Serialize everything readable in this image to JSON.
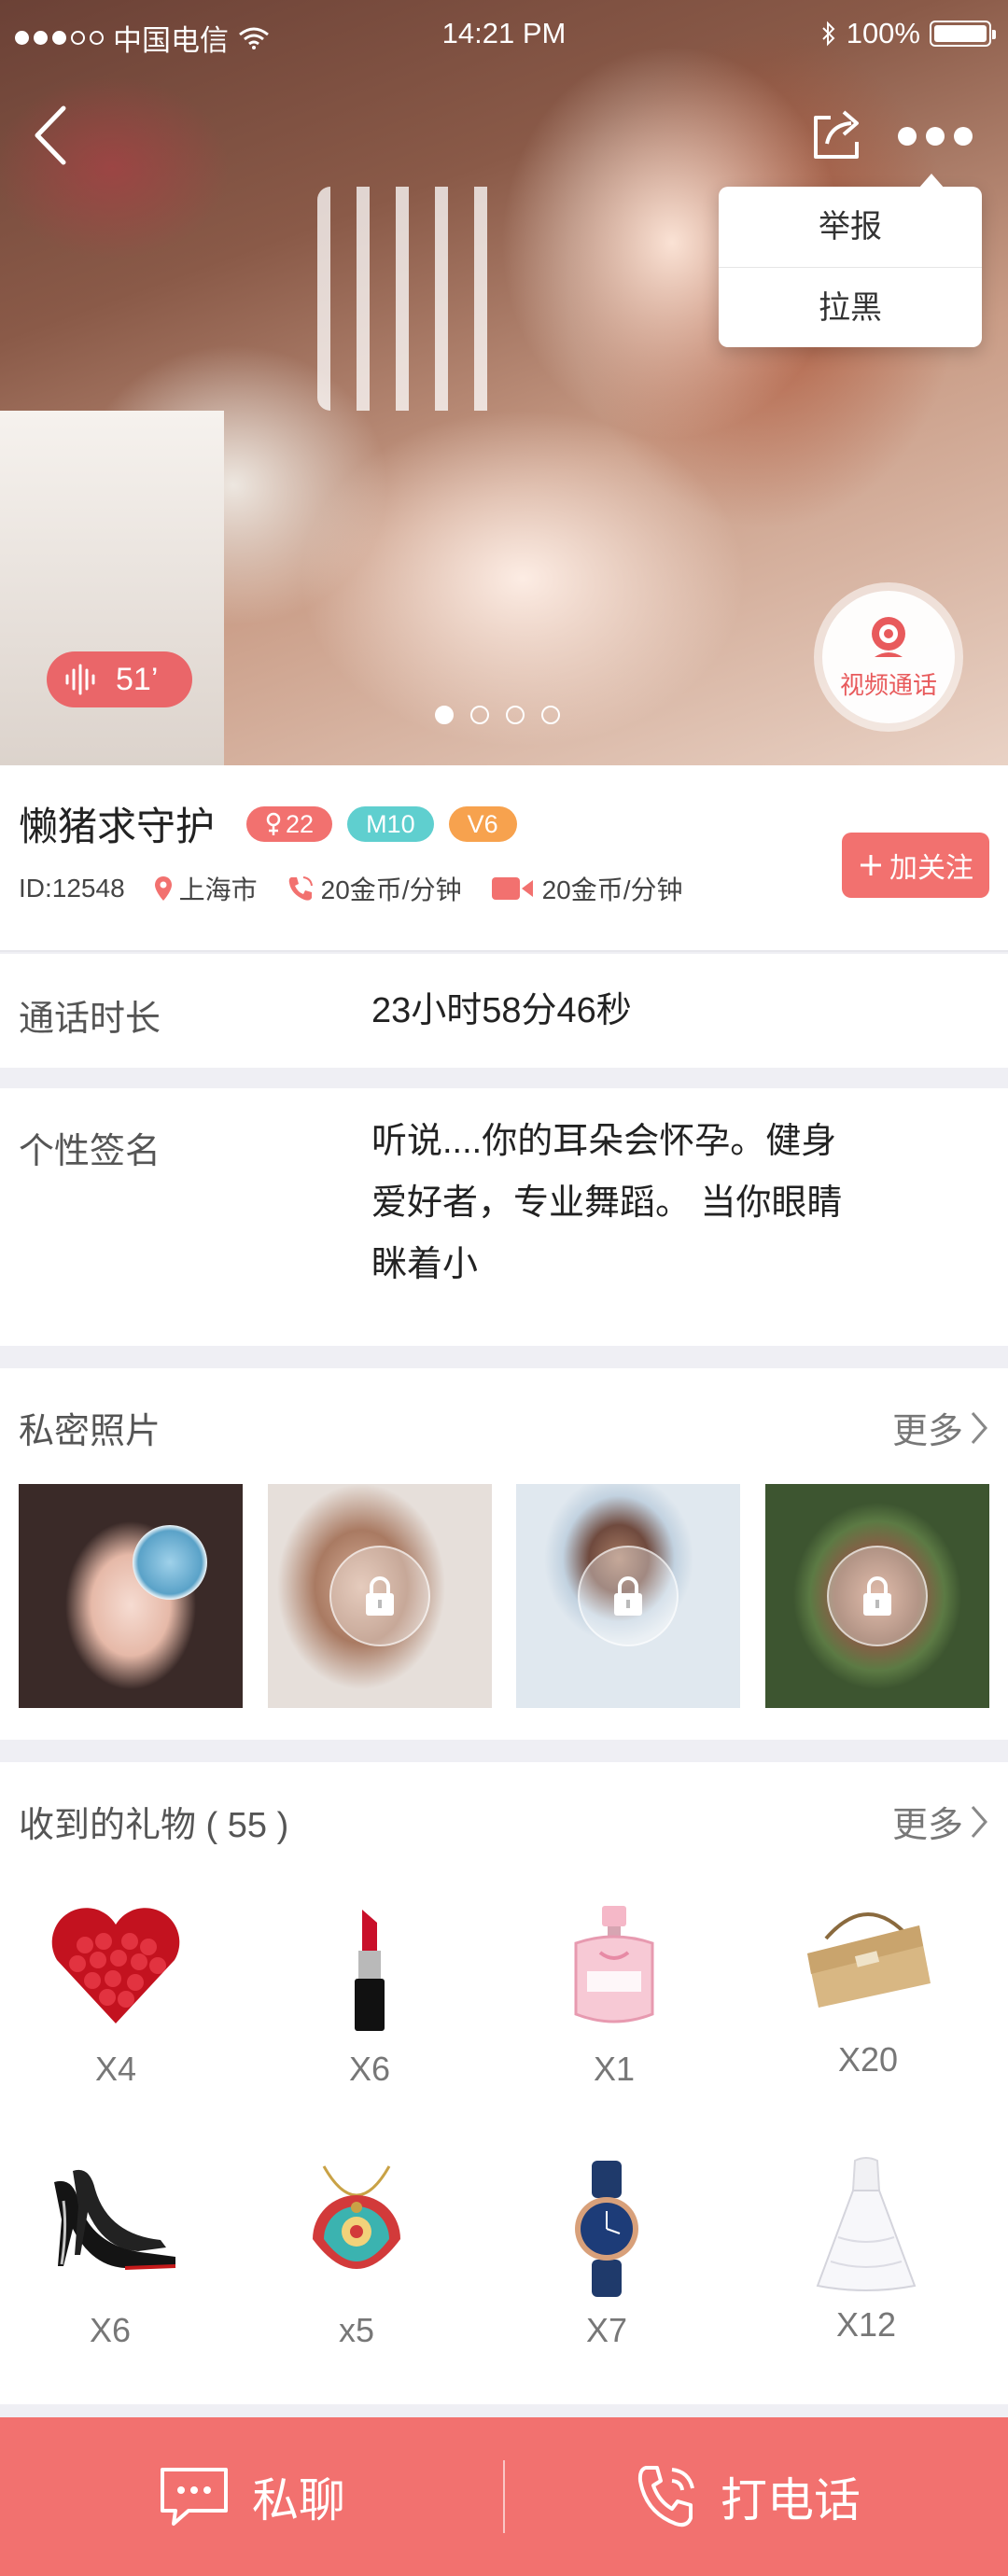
{
  "status_bar": {
    "carrier": "中国电信",
    "time": "14:21 PM",
    "battery": "100%"
  },
  "menu": {
    "items": [
      "举报",
      "拉黑"
    ]
  },
  "hero": {
    "voice_duration": "51’",
    "video_call_label": "视频通话",
    "page_dots": 4,
    "active_dot": 0
  },
  "profile": {
    "nickname": "懒猪求守护",
    "gender_badge": "22",
    "level_badge": "M10",
    "vip_badge": "V6",
    "id": "ID:12548",
    "city": "上海市",
    "voice_price": "20金币/分钟",
    "video_price": "20金币/分钟",
    "follow_label": "加关注"
  },
  "call_duration": {
    "label": "通话时长",
    "value": "23小时58分46秒"
  },
  "signature": {
    "label": "个性签名",
    "lines": [
      "听说....你的耳朵会怀孕。健身",
      "爱好者，专业舞蹈。 当你眼睛",
      "眯着小"
    ]
  },
  "private_photos": {
    "title": "私密照片",
    "more": "更多",
    "photos": [
      {
        "locked": false
      },
      {
        "locked": true
      },
      {
        "locked": true
      },
      {
        "locked": true
      }
    ]
  },
  "gifts": {
    "title": "收到的礼物 ( 55 )",
    "more": "更多",
    "items": [
      {
        "icon": "rose-heart-icon",
        "count": "X4"
      },
      {
        "icon": "lipstick-icon",
        "count": "X6"
      },
      {
        "icon": "perfume-icon",
        "count": "X1"
      },
      {
        "icon": "handbag-icon",
        "count": "X20"
      },
      {
        "icon": "high-heels-icon",
        "count": "X6"
      },
      {
        "icon": "necklace-icon",
        "count": "x5"
      },
      {
        "icon": "watch-icon",
        "count": "X7"
      },
      {
        "icon": "wedding-dress-icon",
        "count": "X12"
      }
    ]
  },
  "bottom_bar": {
    "chat_label": "私聊",
    "call_label": "打电话"
  },
  "colors": {
    "accent": "#f2716f",
    "level": "#5fcfcf",
    "vip": "#f7a24e",
    "background": "#efeff4"
  }
}
